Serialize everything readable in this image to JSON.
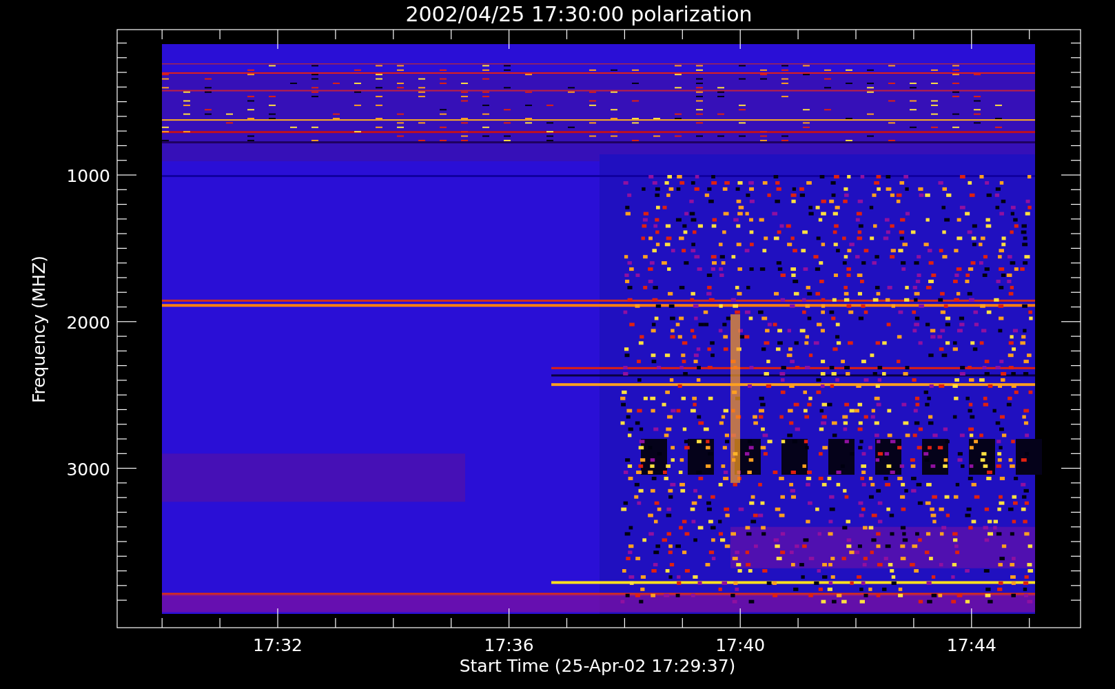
{
  "title": "2002/04/25 17:30:00 polarization",
  "plot": {
    "xlabel": "Start Time (25-Apr-02 17:29:37)",
    "ylabel": "Frequency (MHZ)",
    "xticks": [
      "17:32",
      "17:36",
      "17:40",
      "17:44"
    ],
    "yticks": [
      "1000",
      "2000",
      "3000"
    ]
  }
}
